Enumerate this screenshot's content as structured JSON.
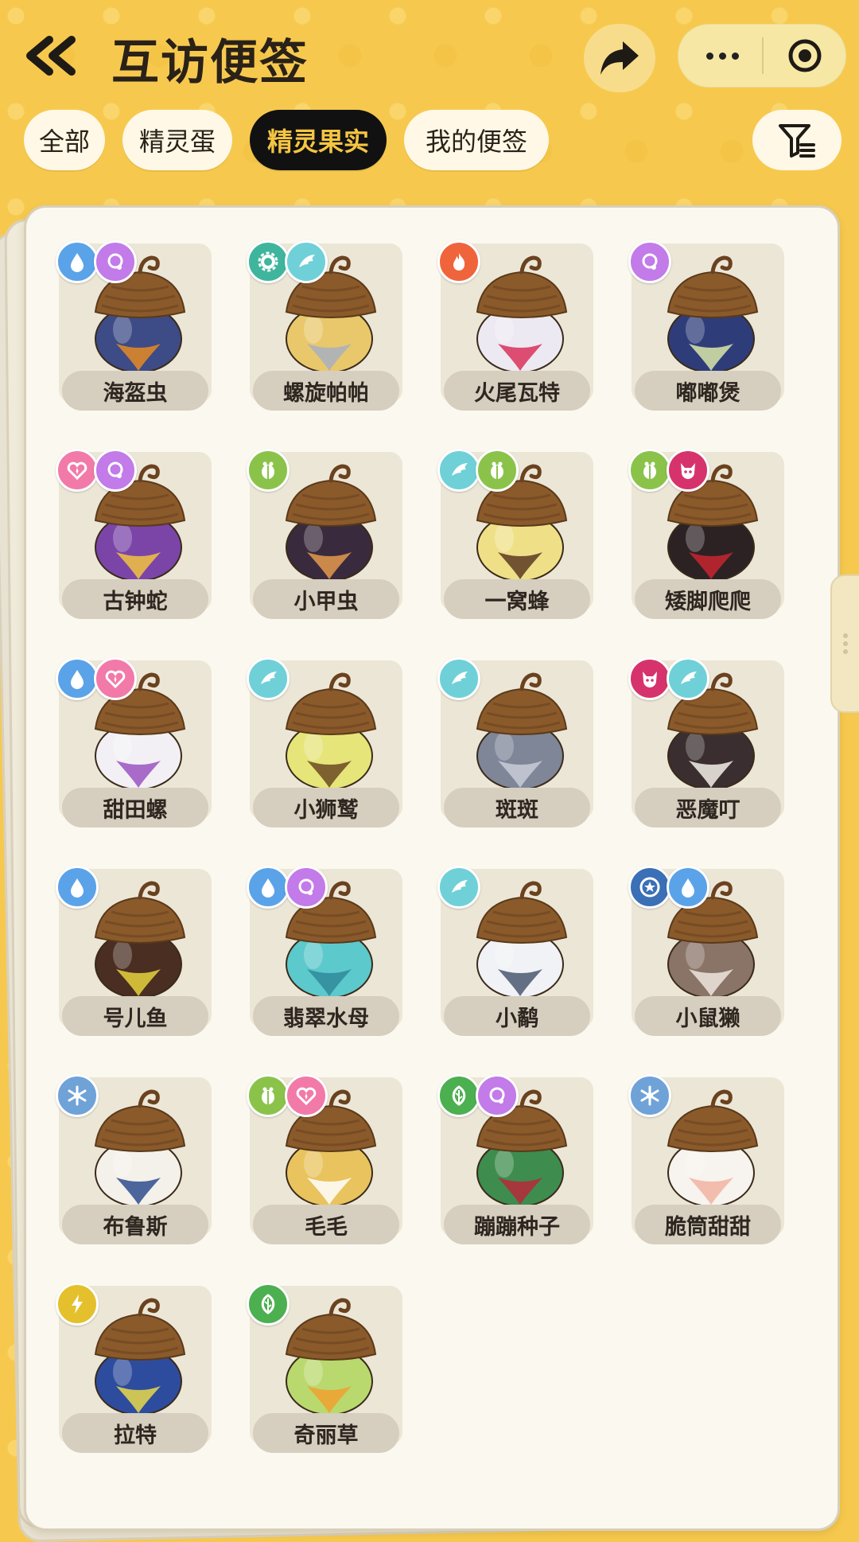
{
  "header": {
    "title": "互访便签"
  },
  "tabs": [
    {
      "label": "全部"
    },
    {
      "label": "精灵蛋"
    },
    {
      "label": "精灵果实",
      "active": true
    },
    {
      "label": "我的便签"
    }
  ],
  "colors": {
    "water": "#5BA3E8",
    "psychic": "#C27BE8",
    "mech": "#3FB59D",
    "wing": "#6FD0D8",
    "fire": "#F0643C",
    "love": "#F27AA8",
    "bug": "#8BC34A",
    "demon": "#D6336C",
    "star": "#3B6FB6",
    "ice": "#6FA3D8",
    "grass": "#4CAF50",
    "electric": "#E4C02C"
  },
  "fruits": [
    {
      "name": "海盔虫",
      "badges": [
        "water",
        "psychic"
      ],
      "body": "#3D4B86",
      "accent": "#E58A22"
    },
    {
      "name": "螺旋帕帕",
      "badges": [
        "mech",
        "wing"
      ],
      "body": "#E9C86C",
      "accent": "#A8B0C0"
    },
    {
      "name": "火尾瓦特",
      "badges": [
        "fire"
      ],
      "body": "#EDE9F2",
      "accent": "#D8315B"
    },
    {
      "name": "嘟嘟煲",
      "badges": [
        "psychic"
      ],
      "body": "#2E3D7A",
      "accent": "#D8E6A8"
    },
    {
      "name": "古钟蛇",
      "badges": [
        "love",
        "psychic"
      ],
      "body": "#7B45A8",
      "accent": "#F2C341"
    },
    {
      "name": "小甲虫",
      "badges": [
        "bug"
      ],
      "body": "#3A2A3E",
      "accent": "#E49A4C"
    },
    {
      "name": "一窝蜂",
      "badges": [
        "wing",
        "bug"
      ],
      "body": "#EFE088",
      "accent": "#5A3A22"
    },
    {
      "name": "矮脚爬爬",
      "badges": [
        "bug",
        "demon"
      ],
      "body": "#2C2224",
      "accent": "#C8262F"
    },
    {
      "name": "甜田螺",
      "badges": [
        "water",
        "love"
      ],
      "body": "#F2F0F5",
      "accent": "#9B54C2"
    },
    {
      "name": "小狮鹫",
      "badges": [
        "wing"
      ],
      "body": "#E6E57A",
      "accent": "#6A4A22"
    },
    {
      "name": "斑斑",
      "badges": [
        "wing"
      ],
      "body": "#7E8698",
      "accent": "#C9CDD8"
    },
    {
      "name": "恶魔叮",
      "badges": [
        "demon",
        "wing"
      ],
      "body": "#3A2E30",
      "accent": "#F3EFE6"
    },
    {
      "name": "号儿鱼",
      "badges": [
        "water"
      ],
      "body": "#4A2E22",
      "accent": "#E5D23C"
    },
    {
      "name": "翡翠水母",
      "badges": [
        "water",
        "psychic"
      ],
      "body": "#5CC9CC",
      "accent": "#2E8A9A"
    },
    {
      "name": "小鹬",
      "badges": [
        "wing"
      ],
      "body": "#F0F2F5",
      "accent": "#4A5870"
    },
    {
      "name": "小鼠獭",
      "badges": [
        "star",
        "water"
      ],
      "body": "#8A7468",
      "accent": "#EDE6DF"
    },
    {
      "name": "布鲁斯",
      "badges": [
        "ice"
      ],
      "body": "#F4F1EA",
      "accent": "#2E4E8E"
    },
    {
      "name": "毛毛",
      "badges": [
        "bug",
        "love"
      ],
      "body": "#E9C35E",
      "accent": "#FFFFFF"
    },
    {
      "name": "蹦蹦种子",
      "badges": [
        "grass",
        "psychic"
      ],
      "body": "#3E8C4E",
      "accent": "#B8283A"
    },
    {
      "name": "脆筒甜甜",
      "badges": [
        "ice"
      ],
      "body": "#F7F3EE",
      "accent": "#F1B3A0"
    },
    {
      "name": "拉特",
      "badges": [
        "electric"
      ],
      "body": "#2E4C9E",
      "accent": "#E8D94A"
    },
    {
      "name": "奇丽草",
      "badges": [
        "grass"
      ],
      "body": "#B9D96E",
      "accent": "#F0A030"
    }
  ]
}
